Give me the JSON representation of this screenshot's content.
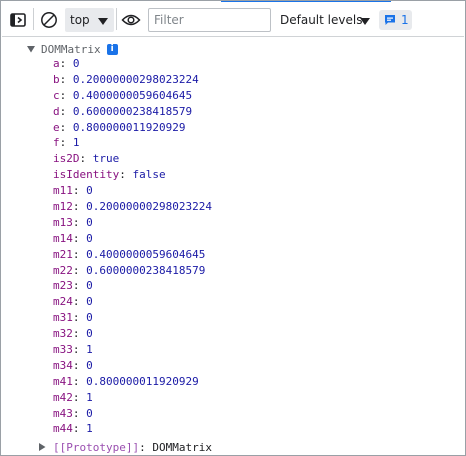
{
  "toolbar": {
    "context": "top",
    "filter_placeholder": "Filter",
    "levels_label": "Default levels",
    "issues_count": "1"
  },
  "object": {
    "name": "DOMMatrix",
    "info_badge": "i",
    "properties": [
      {
        "key": "a",
        "value": "0",
        "type": "number"
      },
      {
        "key": "b",
        "value": "0.20000000298023224",
        "type": "number"
      },
      {
        "key": "c",
        "value": "0.4000000059604645",
        "type": "number"
      },
      {
        "key": "d",
        "value": "0.6000000238418579",
        "type": "number"
      },
      {
        "key": "e",
        "value": "0.800000011920929",
        "type": "number"
      },
      {
        "key": "f",
        "value": "1",
        "type": "number"
      },
      {
        "key": "is2D",
        "value": "true",
        "type": "boolean"
      },
      {
        "key": "isIdentity",
        "value": "false",
        "type": "boolean"
      },
      {
        "key": "m11",
        "value": "0",
        "type": "number"
      },
      {
        "key": "m12",
        "value": "0.20000000298023224",
        "type": "number"
      },
      {
        "key": "m13",
        "value": "0",
        "type": "number"
      },
      {
        "key": "m14",
        "value": "0",
        "type": "number"
      },
      {
        "key": "m21",
        "value": "0.4000000059604645",
        "type": "number"
      },
      {
        "key": "m22",
        "value": "0.6000000238418579",
        "type": "number"
      },
      {
        "key": "m23",
        "value": "0",
        "type": "number"
      },
      {
        "key": "m24",
        "value": "0",
        "type": "number"
      },
      {
        "key": "m31",
        "value": "0",
        "type": "number"
      },
      {
        "key": "m32",
        "value": "0",
        "type": "number"
      },
      {
        "key": "m33",
        "value": "1",
        "type": "number"
      },
      {
        "key": "m34",
        "value": "0",
        "type": "number"
      },
      {
        "key": "m41",
        "value": "0.800000011920929",
        "type": "number"
      },
      {
        "key": "m42",
        "value": "1",
        "type": "number"
      },
      {
        "key": "m43",
        "value": "0",
        "type": "number"
      },
      {
        "key": "m44",
        "value": "1",
        "type": "number"
      }
    ],
    "prototype_key": "[[Prototype]]",
    "prototype_value": "DOMMatrix"
  },
  "icons": {
    "sidebar": "sidebar-toggle-icon",
    "clear": "clear-console-icon",
    "eye": "live-expression-eye-icon",
    "issues": "issues-message-icon"
  },
  "colors": {
    "accent": "#1a73e8",
    "property_key": "#881280",
    "value": "#1a1aa6",
    "prototype_key": "#9a4fb0"
  }
}
